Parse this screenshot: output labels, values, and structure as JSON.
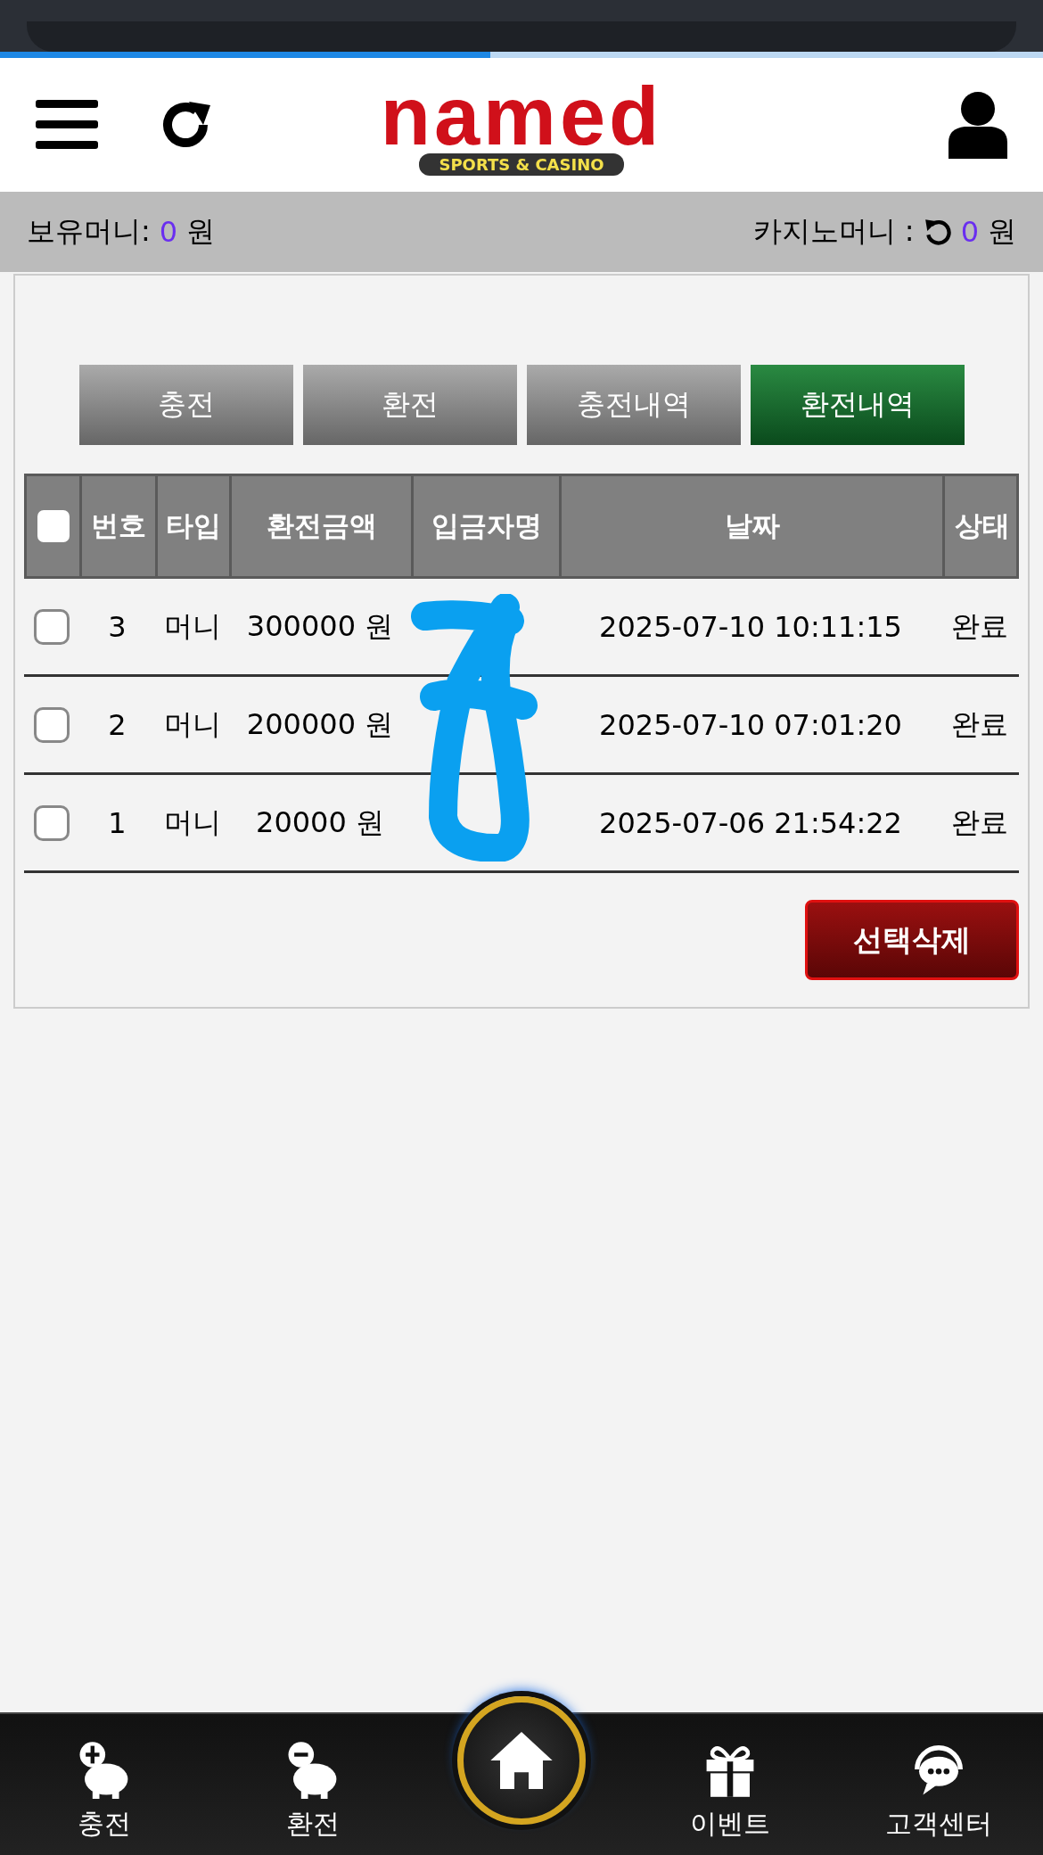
{
  "header": {
    "logo": "named",
    "logo_subtitle": "SPORTS & CASINO"
  },
  "balance": {
    "money_label": "보유머니:",
    "money_value": "0",
    "money_unit": "원",
    "casino_label": "카지노머니 :",
    "casino_value": "0",
    "casino_unit": "원"
  },
  "tabs": [
    {
      "label": "충전",
      "selected": false
    },
    {
      "label": "환전",
      "selected": false
    },
    {
      "label": "충전내역",
      "selected": false
    },
    {
      "label": "환전내역",
      "selected": true
    }
  ],
  "table": {
    "header_checkbox": {
      "checked": false
    },
    "columns": [
      "번호",
      "타입",
      "환전금액",
      "입금자명",
      "날짜",
      "상태"
    ],
    "rows": [
      {
        "checked": false,
        "number": "3",
        "type": "머니",
        "amount": "300000 원",
        "date": "2025-07-10 10:11:15",
        "status": "완료"
      },
      {
        "checked": false,
        "number": "2",
        "type": "머니",
        "amount": "200000 원",
        "date": "2025-07-10 07:01:20",
        "status": "완료"
      },
      {
        "checked": false,
        "number": "1",
        "type": "머니",
        "amount": "20000 원",
        "date": "2025-07-06 21:54:22",
        "status": "완료"
      }
    ]
  },
  "delete_button": "선택삭제",
  "bottom_nav": [
    {
      "kind": "deposit",
      "label": "충전"
    },
    {
      "kind": "withdraw",
      "label": "환전"
    },
    {
      "kind": "home"
    },
    {
      "kind": "event",
      "label": "이벤트"
    },
    {
      "kind": "support",
      "label": "고객센터"
    }
  ]
}
